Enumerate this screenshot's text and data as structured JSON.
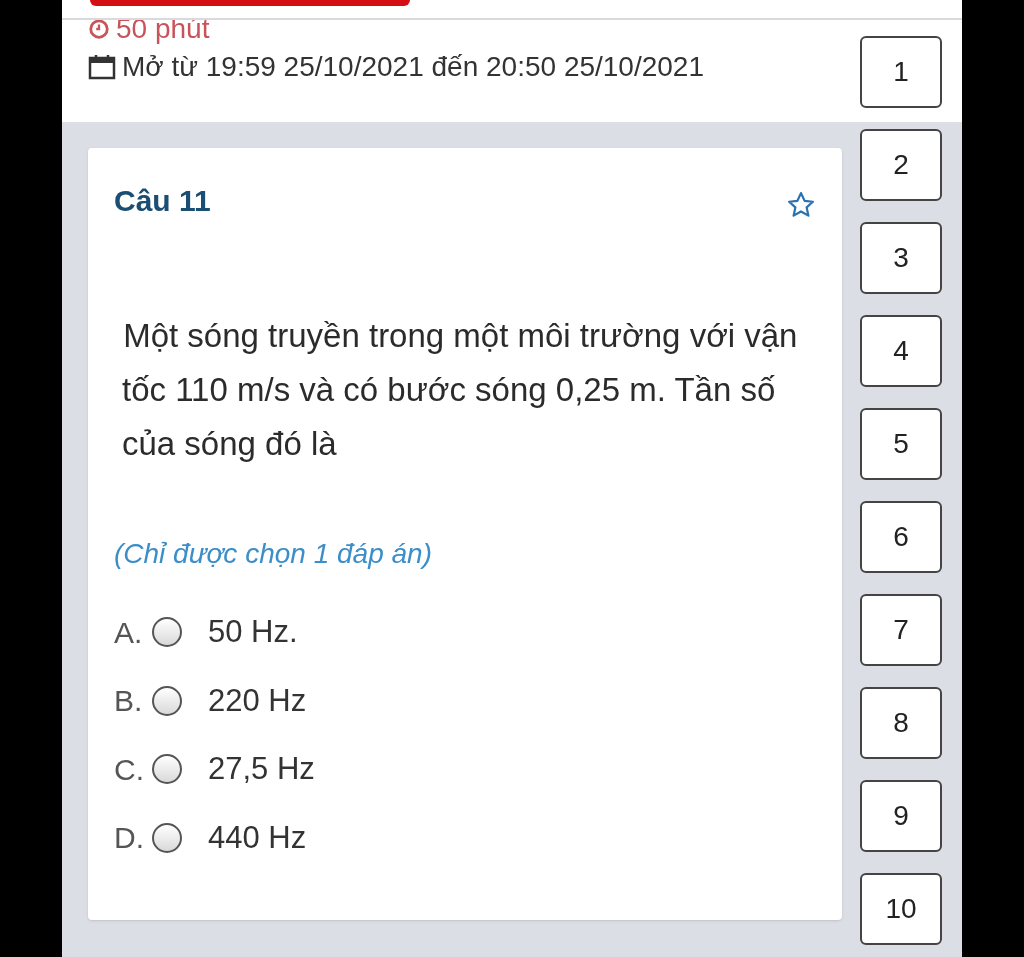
{
  "header": {
    "duration": "50 phút",
    "schedule": "Mở từ 19:59 25/10/2021 đến 20:50 25/10/2021"
  },
  "question": {
    "title": "Câu 11",
    "flagged": false,
    "text": "Một sóng truyền trong một môi trường với vận tốc 110 m/s và có bước sóng 0,25 m. Tần số của sóng đó là",
    "hint": "(Chỉ được chọn 1 đáp án)",
    "options": [
      {
        "letter": "A.",
        "text": "50 Hz.",
        "selected": false
      },
      {
        "letter": "B.",
        "text": "220 Hz",
        "selected": false
      },
      {
        "letter": "C.",
        "text": "27,5 Hz",
        "selected": false
      },
      {
        "letter": "D.",
        "text": "440 Hz",
        "selected": false
      }
    ]
  },
  "nav": [
    "1",
    "2",
    "3",
    "4",
    "5",
    "6",
    "7",
    "8",
    "9",
    "10"
  ]
}
